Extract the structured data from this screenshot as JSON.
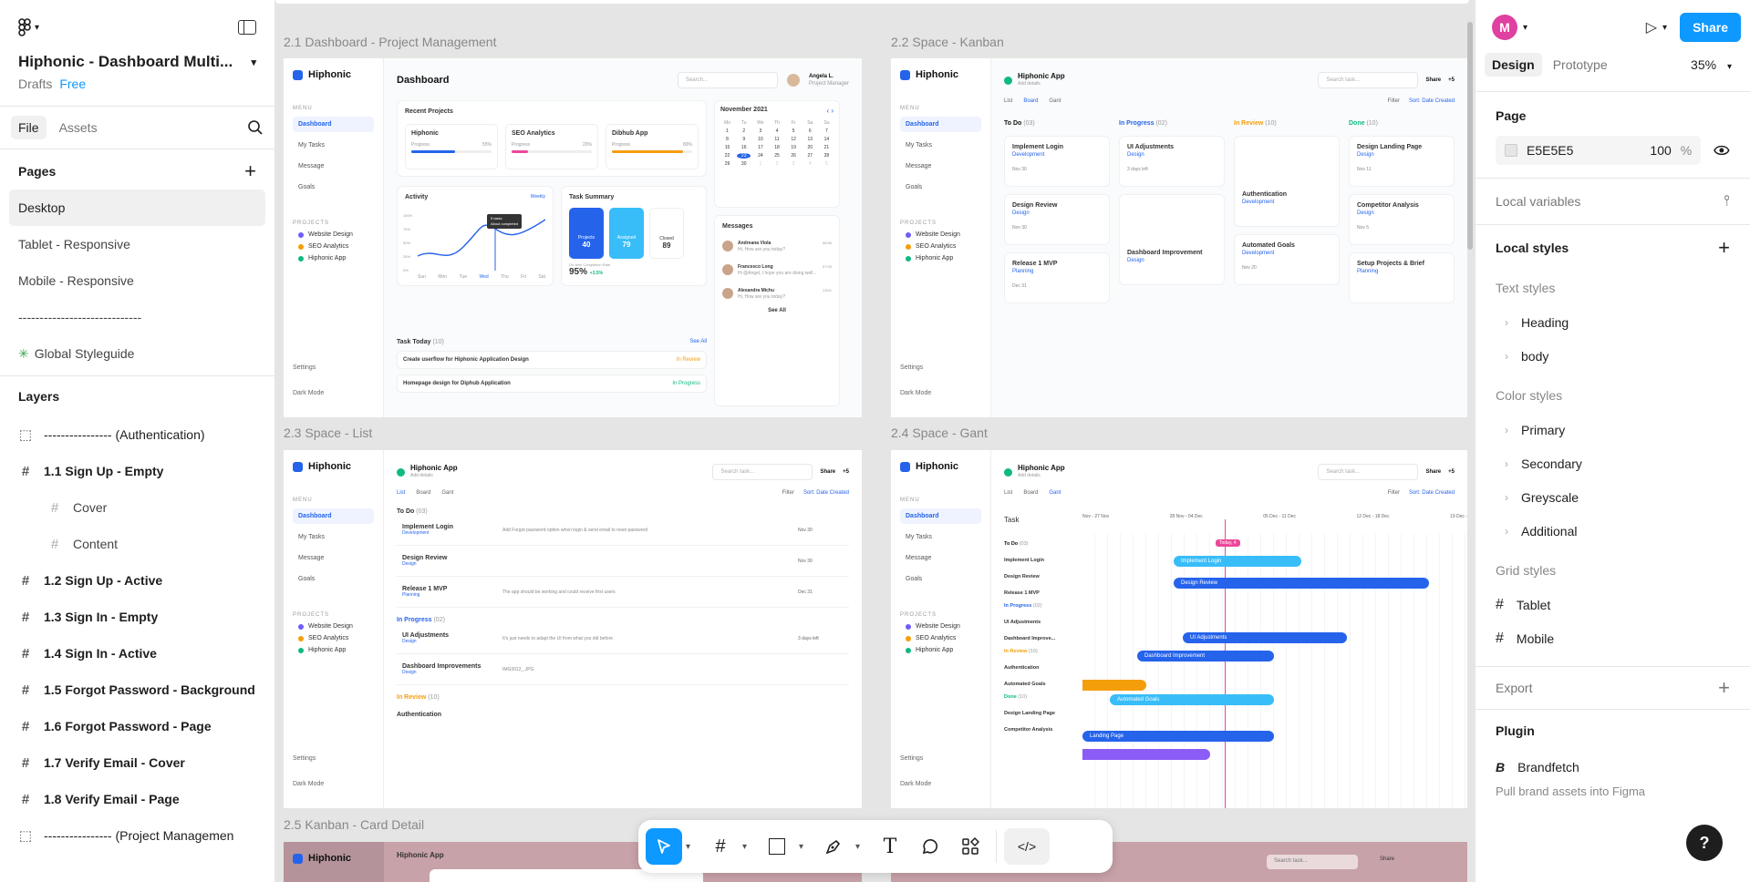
{
  "file": {
    "title": "Hiphonic - Dashboard Multi...",
    "drafts": "Drafts",
    "plan": "Free"
  },
  "left_tabs": {
    "file": "File",
    "assets": "Assets"
  },
  "pages": {
    "heading": "Pages",
    "items": [
      "Desktop",
      "Tablet - Responsive",
      "Mobile - Responsive",
      "-----------------------------",
      "Global Styleguide"
    ]
  },
  "layers": {
    "heading": "Layers",
    "items": [
      {
        "label": "---------------- (Authentication)",
        "icon": "section-icon",
        "kind": "section"
      },
      {
        "label": "1.1 Sign Up - Empty",
        "icon": "frame-icon",
        "kind": "frame"
      },
      {
        "label": "Cover",
        "icon": "frame-icon",
        "kind": "child"
      },
      {
        "label": "Content",
        "icon": "frame-icon",
        "kind": "child"
      },
      {
        "label": "1.2 Sign Up - Active",
        "icon": "frame-icon",
        "kind": "frame"
      },
      {
        "label": "1.3 Sign In - Empty",
        "icon": "frame-icon",
        "kind": "frame"
      },
      {
        "label": "1.4 Sign In - Active",
        "icon": "frame-icon",
        "kind": "frame"
      },
      {
        "label": "1.5 Forgot Password - Background",
        "icon": "frame-icon",
        "kind": "frame"
      },
      {
        "label": "1.6 Forgot Password - Page",
        "icon": "frame-icon",
        "kind": "frame"
      },
      {
        "label": "1.7 Verify Email - Cover",
        "icon": "frame-icon",
        "kind": "frame"
      },
      {
        "label": "1.8 Verify Email - Page",
        "icon": "frame-icon",
        "kind": "frame"
      },
      {
        "label": "---------------- (Project Managemen",
        "icon": "section-icon",
        "kind": "section"
      }
    ]
  },
  "canvas": {
    "frame_labels": [
      "2.1 Dashboard - Project Management",
      "2.2 Space - Kanban",
      "2.3 Space - List",
      "2.4 Space - Gant",
      "2.5 Kanban - Card Detail"
    ],
    "brand": "Hiphonic",
    "menu_heading": "MENU",
    "menu": [
      "Dashboard",
      "My Tasks",
      "Message",
      "Goals"
    ],
    "projects_heading": "PROJECTS",
    "projects": [
      {
        "name": "Website Design",
        "color": "#6d5dfc"
      },
      {
        "name": "SEO Analytics",
        "color": "#f59e0b"
      },
      {
        "name": "Hiphonic App",
        "color": "#10b981"
      }
    ],
    "settings": "Settings",
    "dark_mode": "Dark Mode",
    "dashboard": {
      "title": "Dashboard",
      "search": "Search...",
      "user_name": "Angela L.",
      "user_role": "Project Manager",
      "recent_projects": "Recent Projects",
      "projects": [
        {
          "name": "Hiphonic",
          "progress": "Progress",
          "pct": "55%"
        },
        {
          "name": "SEO Analytics",
          "progress": "Progress",
          "pct": "20%"
        },
        {
          "name": "Dibhub App",
          "progress": "Progress",
          "pct": "89%"
        }
      ],
      "calendar_title": "November 2021",
      "calendar_days": [
        "Mo",
        "Tu",
        "We",
        "Th",
        "Fr",
        "Sa",
        "Su"
      ],
      "calendar_dates": [
        "1",
        "2",
        "3",
        "4",
        "5",
        "6",
        "7",
        "8",
        "9",
        "10",
        "11",
        "12",
        "13",
        "14",
        "15",
        "16",
        "17",
        "18",
        "19",
        "20",
        "21",
        "22",
        "23",
        "24",
        "25",
        "26",
        "27",
        "28",
        "29",
        "30",
        "1",
        "2",
        "3",
        "4",
        "5"
      ],
      "today": "23",
      "activity": "Activity",
      "activity_period": "Weekly",
      "activity_tooltip_1": "5 tasks",
      "activity_tooltip_2": "About completed",
      "activity_y": [
        "100%",
        "75%",
        "50%",
        "25%",
        "0%"
      ],
      "activity_x": [
        "Sun",
        "Mon",
        "Tue",
        "Wed",
        "Thu",
        "Fri",
        "Sat"
      ],
      "task_summary": "Task Summary",
      "summary": [
        {
          "label": "Projects",
          "value": "40"
        },
        {
          "label": "Assigned",
          "value": "79"
        },
        {
          "label": "Closed",
          "value": "89"
        }
      ],
      "on_time_label": "On-time Completion Rate",
      "on_time": "95%",
      "on_time_delta": "+3.5%",
      "messages": "Messages",
      "message_list": [
        {
          "name": "Andreana Viola",
          "text": "Hi, How are you today?",
          "time": "08:50"
        },
        {
          "name": "Francesco Long",
          "text": "Hi @Angel, I hope you are doing well...",
          "time": "07:00"
        },
        {
          "name": "Alexandra Michu",
          "text": "Hi, How are you today?",
          "time": "23/11"
        }
      ],
      "see_all": "See All",
      "task_today": "Task Today",
      "task_today_count": "(10)",
      "tasks": [
        {
          "name": "Create userflow for Hiphonic Application Design",
          "status": "In Review"
        },
        {
          "name": "Homepage design for Diphub Application",
          "status": "In Progress"
        }
      ]
    },
    "kanban": {
      "app": "Hiphonic App",
      "add_details": "Add details",
      "search": "Search task...",
      "share": "Share",
      "extra_members": "+5",
      "views": [
        "List",
        "Board",
        "Gant"
      ],
      "filter": "Filter",
      "sort": "Sort: Date Created",
      "columns": [
        {
          "name": "To Do",
          "count": "(03)",
          "color": "#111111",
          "cards": [
            {
              "title": "Implement Login",
              "tag": "Development",
              "date": "Nov 30"
            },
            {
              "title": "Design Review",
              "tag": "Design",
              "date": "Nov 30"
            },
            {
              "title": "Release 1 MVP",
              "tag": "Planning",
              "date": "Dec 31"
            }
          ]
        },
        {
          "name": "In Progress",
          "count": "(02)",
          "color": "#2563eb",
          "cards": [
            {
              "title": "UI Adjustments",
              "tag": "Design",
              "date": "3 days left"
            },
            {
              "title": "Dashboard Improvement",
              "tag": "Design",
              "date": ""
            }
          ]
        },
        {
          "name": "In Review",
          "count": "(10)",
          "color": "#f59e0b",
          "cards": [
            {
              "title": "Authentication",
              "tag": "Development",
              "date": ""
            },
            {
              "title": "Automated Goals",
              "tag": "Development",
              "date": "Nov 20"
            }
          ]
        },
        {
          "name": "Done",
          "count": "(10)",
          "color": "#10b981",
          "cards": [
            {
              "title": "Design Landing Page",
              "tag": "Design",
              "date": "Nov 11"
            },
            {
              "title": "Competitor Analysis",
              "tag": "Design",
              "date": "Nov 5"
            },
            {
              "title": "Setup Projects & Brief",
              "tag": "Planning",
              "date": ""
            }
          ]
        }
      ]
    },
    "list": {
      "todo": "To Do",
      "todo_count": "(03)",
      "rows": [
        {
          "title": "Implement Login",
          "tag": "Development",
          "desc": "Add Forgot password option when login & send email to reset password",
          "date": "Nov 30"
        },
        {
          "title": "Design Review",
          "tag": "Design",
          "desc": "",
          "date": "Nov 30"
        },
        {
          "title": "Release 1 MVP",
          "tag": "Planning",
          "desc": "The app should be working and could receive first users",
          "date": "Dec 31"
        }
      ],
      "inprogress": "In Progress",
      "inprogress_count": "(02)",
      "rows2": [
        {
          "title": "UI Adjustments",
          "tag": "Design",
          "desc": "It's just needs to adapt the UI from what you did before",
          "date": "3 days left"
        },
        {
          "title": "Dashboard Improvements",
          "tag": "Design",
          "desc": "IMG0012_.JPG",
          "date": ""
        }
      ],
      "inreview": "In Review",
      "inreview_count": "(10)",
      "next_row": "Authentication"
    },
    "gant": {
      "task": "Task",
      "weeks": [
        "Nov - 27 Nov",
        "28 Nov - 04 Dec",
        "05 Dec - 11 Dec",
        "12 Dec - 18 Dec",
        "19 Dec -"
      ],
      "today": "Today, 4",
      "groups": [
        {
          "name": "To Do",
          "count": "(03)",
          "items": [
            "Implement Login",
            "Design Review",
            "Release 1 MVP"
          ]
        },
        {
          "name": "In Progress",
          "count": "(02)",
          "items": [
            "UI Adjustments",
            "Dashboard Improve..."
          ]
        },
        {
          "name": "In Review",
          "count": "(10)",
          "items": [
            "Authentication",
            "Automated Goals"
          ]
        },
        {
          "name": "Done",
          "count": "(10)",
          "items": [
            "Design Landing Page",
            "Competitor Analysis"
          ]
        }
      ],
      "bars": [
        "Implement Login",
        "Design Review",
        "UI Adjustments",
        "Dashboard Improvement",
        "Automated Goals",
        "Landing Page"
      ]
    }
  },
  "right": {
    "avatar": "M",
    "share": "Share",
    "tabs": [
      "Design",
      "Prototype"
    ],
    "zoom": "35%",
    "page_heading": "Page",
    "page_color": "E5E5E5",
    "page_opacity": "100",
    "page_opacity_unit": "%",
    "local_variables": "Local variables",
    "local_styles": "Local styles",
    "text_styles": "Text styles",
    "text_style_items": [
      "Heading",
      "body"
    ],
    "color_styles": "Color styles",
    "color_style_items": [
      "Primary",
      "Secondary",
      "Greyscale",
      "Additional"
    ],
    "grid_styles": "Grid styles",
    "grid_style_items": [
      "Tablet",
      "Mobile"
    ],
    "export": "Export",
    "plugin": "Plugin",
    "plugin_name": "Brandfetch",
    "plugin_desc": "Pull brand assets into Figma"
  },
  "help": "?"
}
